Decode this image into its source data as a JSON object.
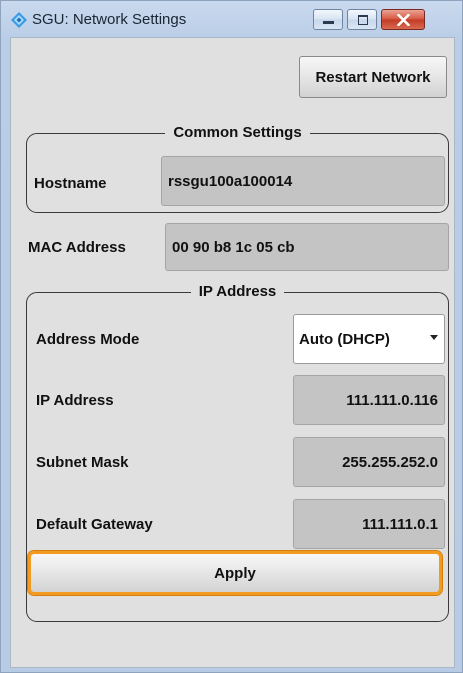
{
  "window": {
    "title": "SGU: Network Settings",
    "app_icon": "rohde-schwarz-diamond-icon"
  },
  "toolbar": {
    "restart_label": "Restart Network"
  },
  "common_settings": {
    "title": "Common Settings",
    "hostname_label": "Hostname",
    "hostname_value": "rssgu100a100014"
  },
  "mac": {
    "label": "MAC Address",
    "value": "00 90 b8 1c 05 cb"
  },
  "ip_group": {
    "title": "IP Address",
    "address_mode_label": "Address Mode",
    "address_mode_value": "Auto (DHCP)",
    "ip_label": "IP Address",
    "ip_value": "111.111.0.116",
    "subnet_label": "Subnet Mask",
    "subnet_value": "255.255.252.0",
    "gateway_label": "Default Gateway",
    "gateway_value": "111.111.0.1"
  },
  "apply_label": "Apply",
  "colors": {
    "focus_outline": "#f39a21",
    "close_button": "#c23a24",
    "field_bg": "#c4c4c4"
  }
}
